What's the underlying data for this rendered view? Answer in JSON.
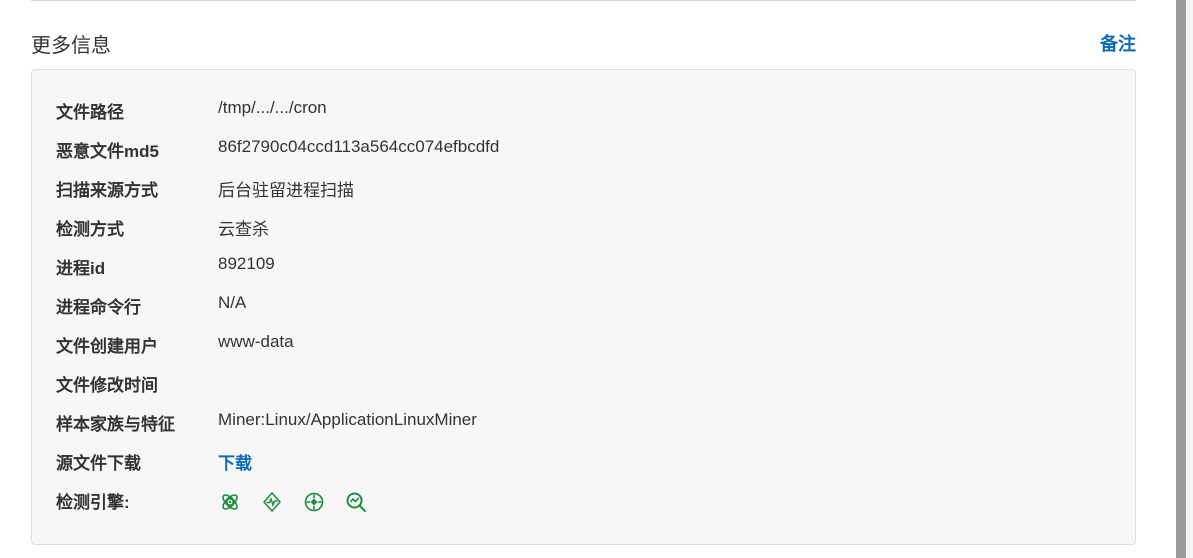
{
  "section": {
    "title": "更多信息",
    "remark_label": "备注"
  },
  "info": {
    "rows": [
      {
        "label": "文件路径",
        "value": "/tmp/.../.../cron"
      },
      {
        "label": "恶意文件md5",
        "value": "86f2790c04ccd113a564cc074efbcdfd"
      },
      {
        "label": "扫描来源方式",
        "value": "后台驻留进程扫描"
      },
      {
        "label": "检测方式",
        "value": "云查杀"
      },
      {
        "label": "进程id",
        "value": "892109"
      },
      {
        "label": "进程命令行",
        "value": "N/A"
      },
      {
        "label": "文件创建用户",
        "value": "www-data"
      },
      {
        "label": "文件修改时间",
        "value": ""
      },
      {
        "label": "样本家族与特征",
        "value": "Miner:Linux/ApplicationLinuxMiner"
      }
    ],
    "download": {
      "label": "源文件下载",
      "link_text": "下载"
    },
    "engines": {
      "label": "检测引擎:",
      "icons": [
        "atom-engine-icon",
        "pulse-engine-icon",
        "target-engine-icon",
        "search-analysis-engine-icon"
      ],
      "color": "#1a8f3c"
    }
  },
  "colors": {
    "accent": "#0f6bb8",
    "engine_green": "#1a8f3c",
    "card_bg": "#f7f7f7",
    "text": "#333333"
  }
}
